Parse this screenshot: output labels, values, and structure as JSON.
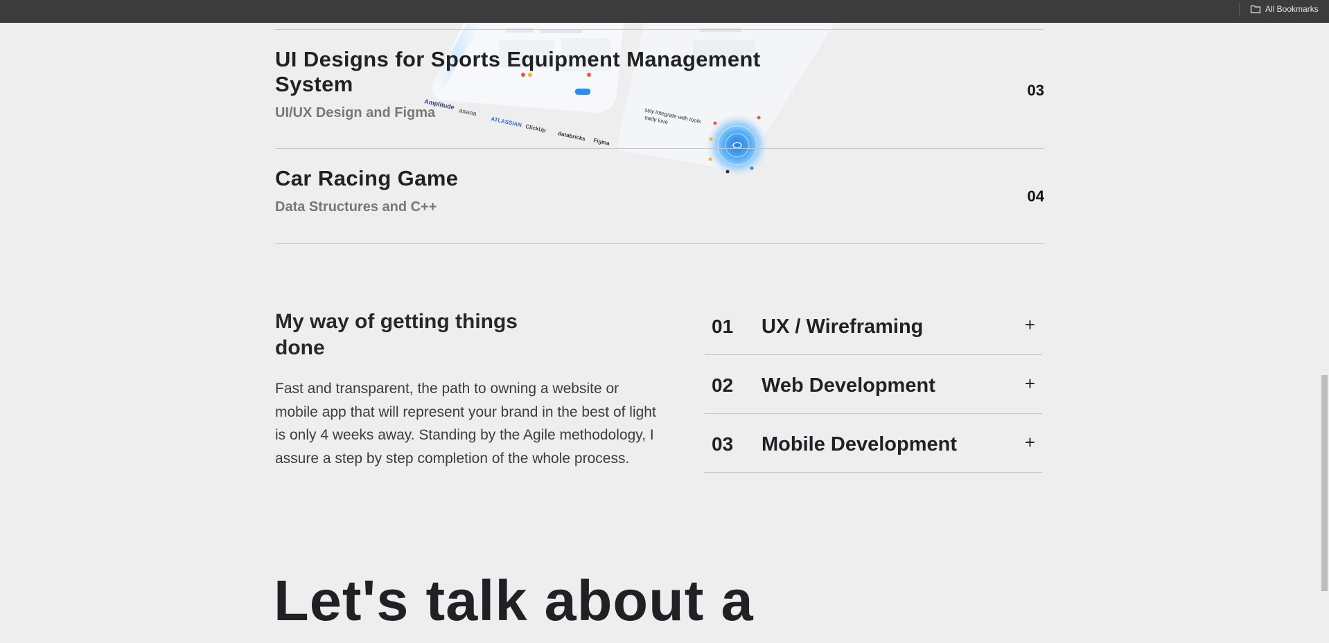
{
  "browser": {
    "bookmarks_label": "All Bookmarks"
  },
  "projects": [
    {
      "title": "UI Designs for Sports Equipment Management System",
      "subtitle": "UI/UX Design and Figma",
      "number": "03"
    },
    {
      "title": "Car Racing Game",
      "subtitle": "Data Structures and C++",
      "number": "04"
    }
  ],
  "preview": {
    "logos": [
      "Amplitude",
      "asana",
      "ATLASSIAN",
      "ClickUp",
      "databricks",
      "Figma"
    ],
    "caption_line1": "ssly integrate with tools",
    "caption_line2": "eady love"
  },
  "process": {
    "title": "My way of getting things done",
    "description": "Fast and transparent, the path to owning a website or mobile app that will represent your brand in the best of light is only 4 weeks away. Standing by the Agile methodology, I assure a step by step completion of the whole process."
  },
  "services": [
    {
      "number": "01",
      "label": "UX / Wireframing",
      "toggle": "+"
    },
    {
      "number": "02",
      "label": "Web Development",
      "toggle": "+"
    },
    {
      "number": "03",
      "label": "Mobile Development",
      "toggle": "+"
    }
  ],
  "cta": {
    "headline": "Let's talk about a"
  },
  "colors": {
    "background": "#eeeeee",
    "text": "#1f2125",
    "muted": "#777777",
    "accent": "#2e8cf0"
  }
}
